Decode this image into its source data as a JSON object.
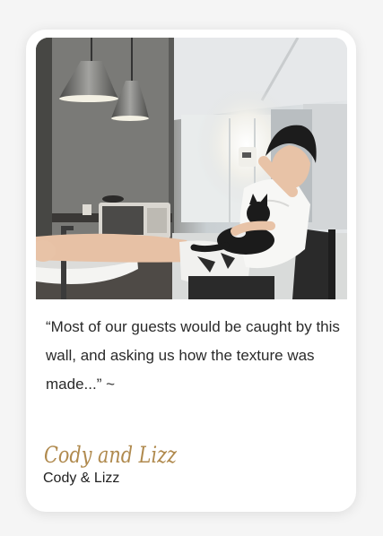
{
  "testimonial": {
    "quote": "“Most of our guests would be caught by this wall, and asking us how the texture was made...” ~",
    "signature_text": "Cody and Lizz",
    "author": "Cody & Lizz"
  },
  "photo": {
    "subject": "man-drinking-from-mug-with-black-cat-on-lap"
  },
  "colors": {
    "signature": "#b08a4e",
    "quote_text": "#2a2a2a",
    "card_background": "#ffffff"
  }
}
